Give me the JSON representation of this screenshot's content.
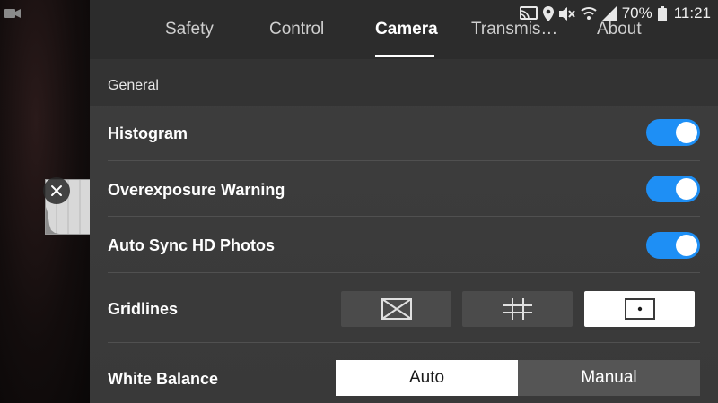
{
  "status_bar": {
    "battery_percent": "70%",
    "time": "11:21",
    "icons": [
      "cast-icon",
      "location-icon",
      "mute-icon",
      "wifi-icon",
      "signal-icon",
      "battery-icon"
    ]
  },
  "tabs": [
    {
      "label": "Safety",
      "active": false
    },
    {
      "label": "Control",
      "active": false
    },
    {
      "label": "Camera",
      "active": true
    },
    {
      "label": "Transmis…",
      "active": false
    },
    {
      "label": "About",
      "active": false
    }
  ],
  "section": {
    "title": "General"
  },
  "settings": {
    "histogram": {
      "label": "Histogram",
      "enabled": true
    },
    "overexposure_warning": {
      "label": "Overexposure Warning",
      "enabled": true
    },
    "auto_sync_hd_photos": {
      "label": "Auto Sync HD Photos",
      "enabled": true
    },
    "gridlines": {
      "label": "Gridlines",
      "options": [
        "diagonal-grid-icon",
        "grid-lines-icon",
        "center-point-icon"
      ],
      "selected": "center-point-icon"
    },
    "white_balance": {
      "label": "White Balance",
      "options": [
        "Auto",
        "Manual"
      ],
      "selected": "Auto"
    }
  },
  "colors": {
    "accent": "#1e8ff5",
    "panel_bg": "#3a3a3a",
    "tab_bar_bg": "#2c2c2c"
  }
}
